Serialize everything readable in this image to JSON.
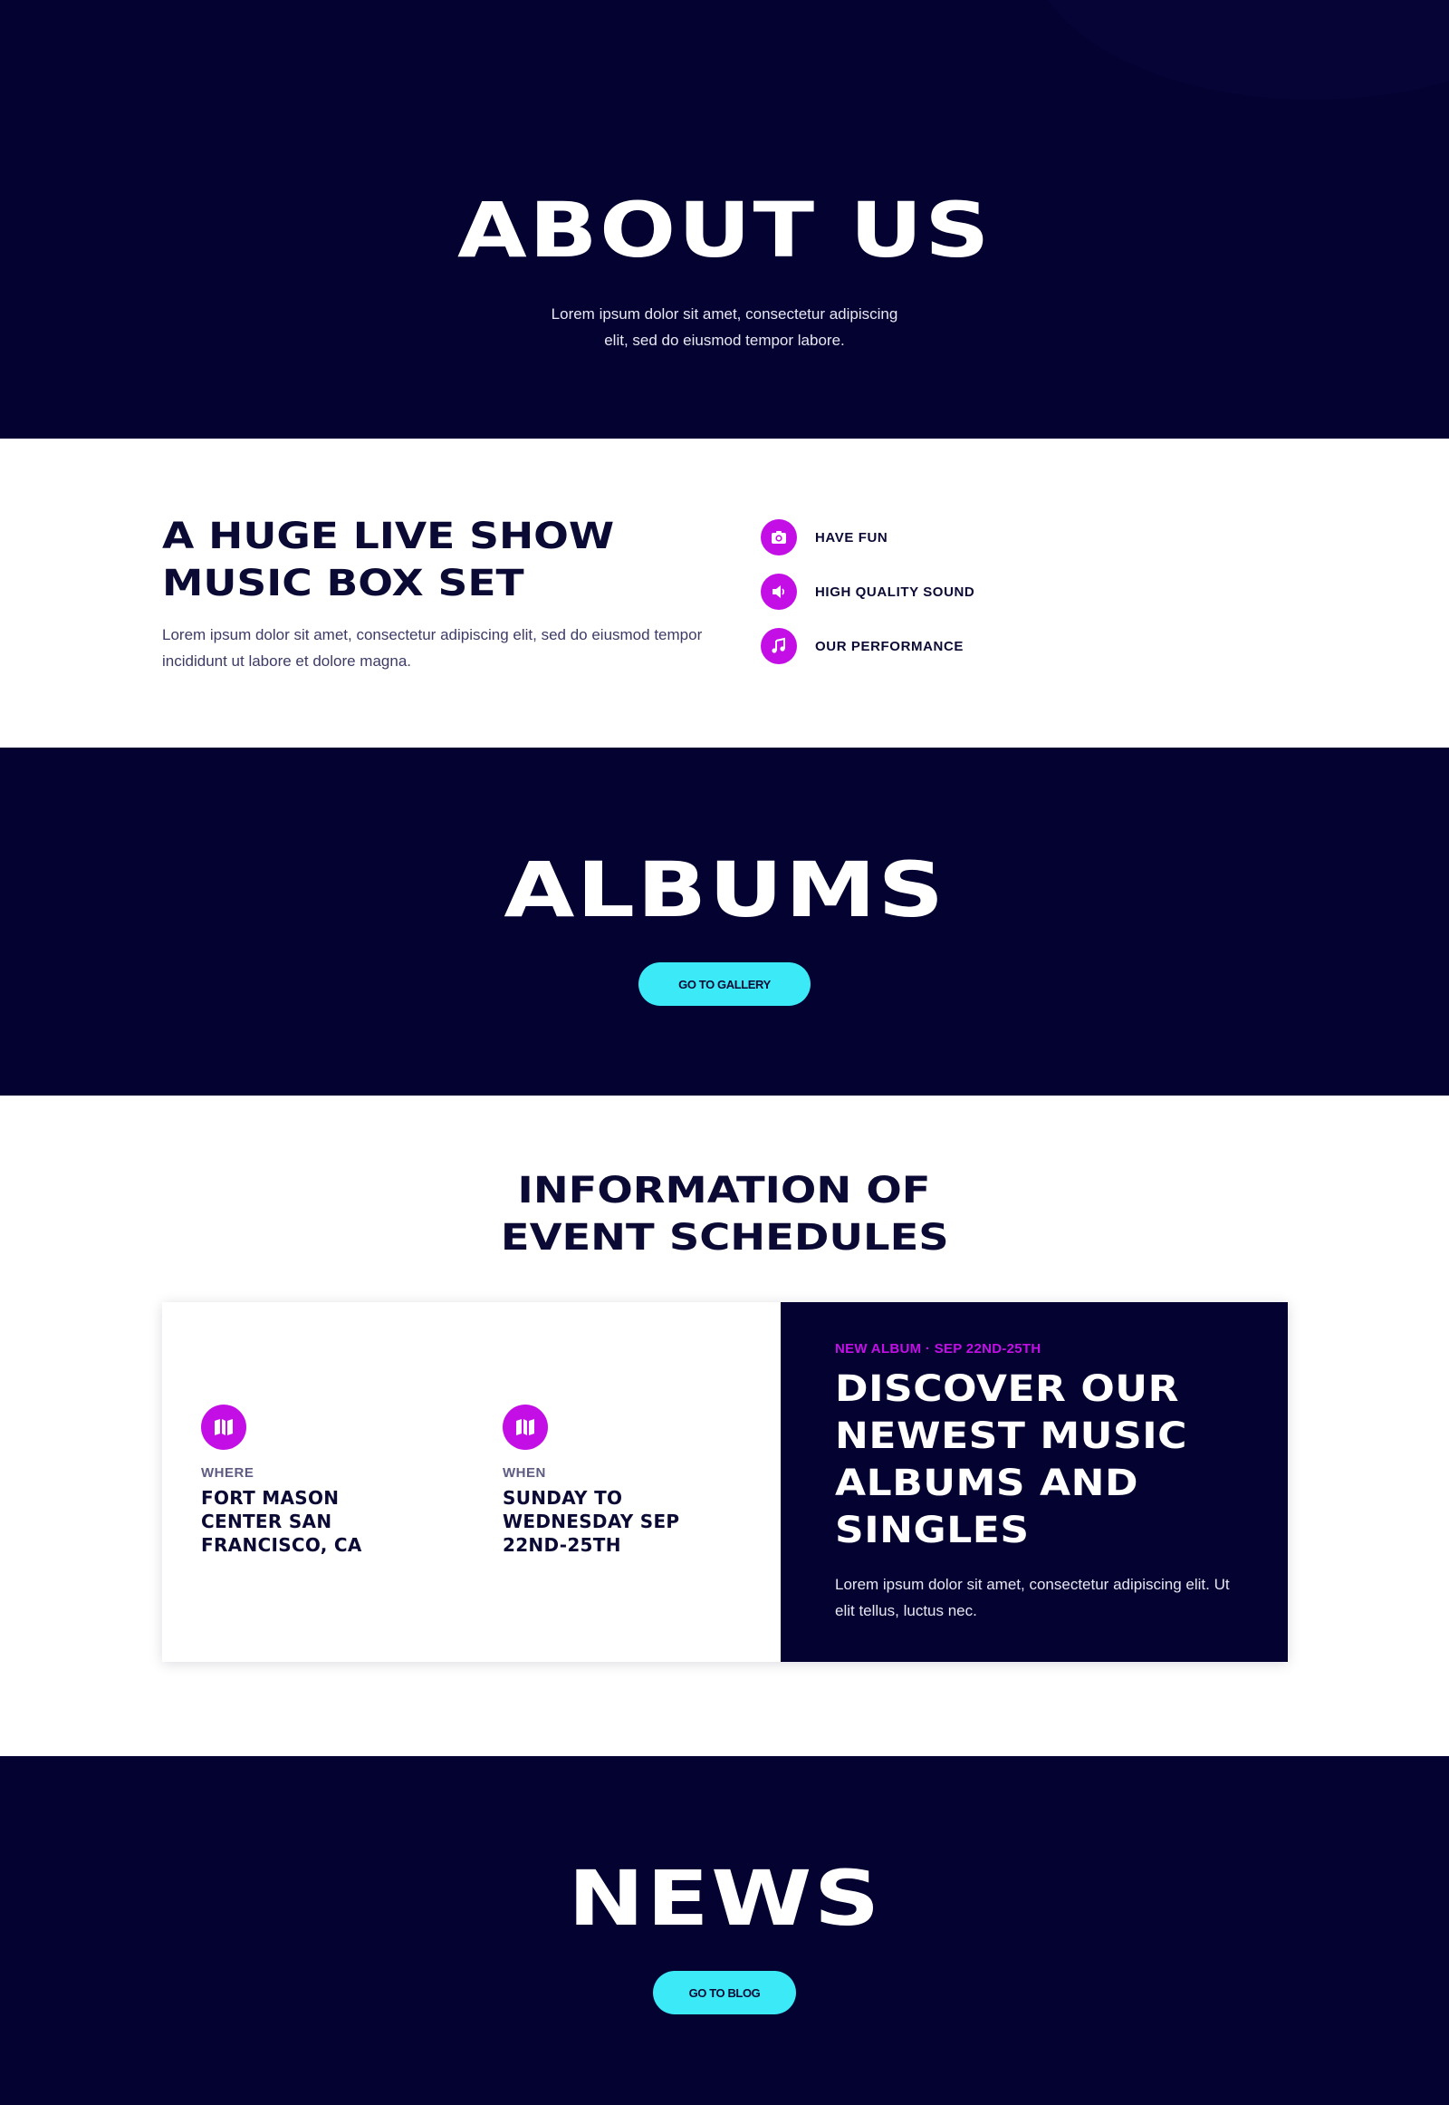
{
  "hero": {
    "title": "ABOUT US",
    "subtitle": "Lorem ipsum dolor sit amet, consectetur adipiscing elit, sed do eiusmod tempor labore."
  },
  "features": {
    "title": "A HUGE LIVE SHOW MUSIC BOX SET",
    "description": "Lorem ipsum dolor sit amet, consectetur adipiscing elit, sed do eiusmod tempor incididunt ut labore et dolore magna.",
    "items": [
      {
        "label": "HAVE FUN",
        "icon": "camera-icon"
      },
      {
        "label": "HIGH QUALITY SOUND",
        "icon": "speaker-icon"
      },
      {
        "label": "OUR PERFORMANCE",
        "icon": "music-note-icon"
      }
    ]
  },
  "albums": {
    "title": "ALBUMS",
    "button_label": "GO TO GALLERY"
  },
  "schedule": {
    "title_line1": "INFORMATION OF",
    "title_line2": "EVENT SCHEDULES",
    "where": {
      "kicker": "WHERE",
      "value": "FORT MASON CENTER SAN FRANCISCO, CA",
      "icon": "map-icon"
    },
    "when": {
      "kicker": "WHEN",
      "value": "SUNDAY TO WEDNESDAY SEP 22ND-25TH",
      "icon": "map-icon"
    },
    "promo": {
      "tag": "NEW ALBUM · SEP 22ND-25TH",
      "title": "DISCOVER OUR NEWEST MUSIC ALBUMS AND SINGLES",
      "description": "Lorem ipsum dolor sit amet, consectetur adipiscing elit. Ut elit tellus, luctus nec."
    }
  },
  "news": {
    "title": "NEWS",
    "button_label": "GO TO BLOG"
  },
  "colors": {
    "navy": "#040230",
    "magenta": "#c30fe6",
    "cyan": "#3ce9f6",
    "white": "#ffffff"
  }
}
